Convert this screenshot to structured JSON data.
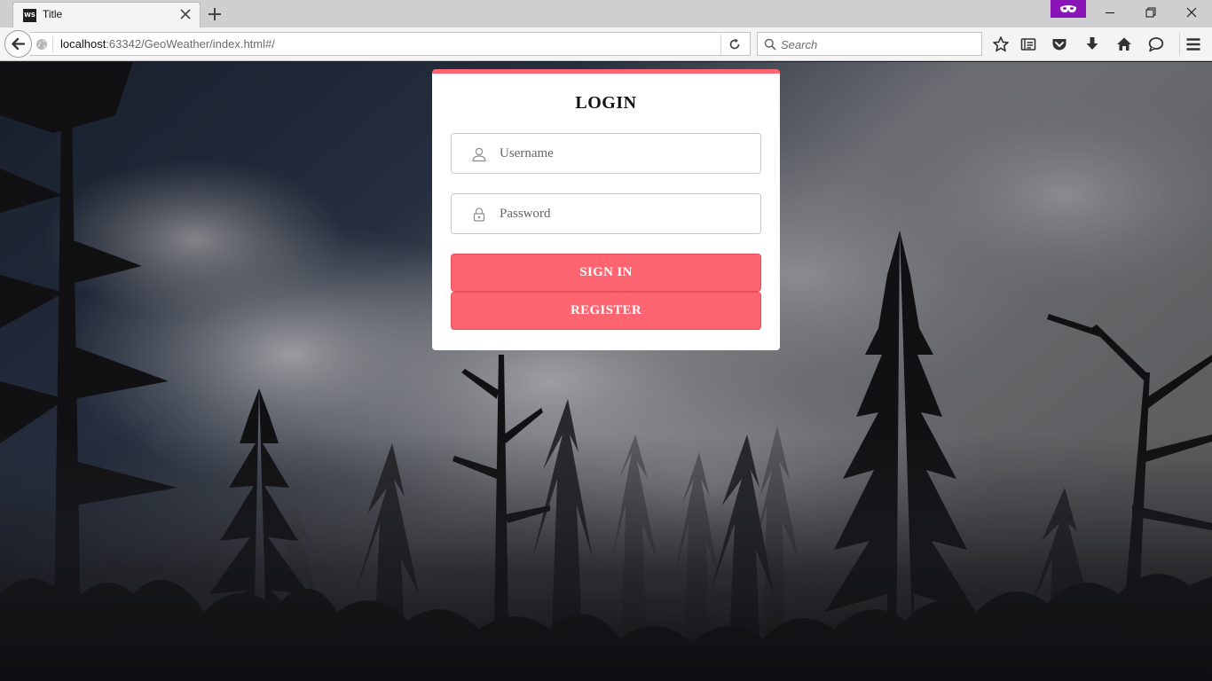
{
  "browser": {
    "tab_title": "Title",
    "tab_favicon": "WS",
    "url_host": "localhost",
    "url_rest": ":63342/GeoWeather/index.html#/",
    "search_placeholder": "Search",
    "accent_private": "#8a14b7"
  },
  "login": {
    "title": "LOGIN",
    "username_placeholder": "Username",
    "password_placeholder": "Password",
    "signin_label": "SIGN IN",
    "register_label": "REGISTER",
    "accent_color": "#ff6571"
  }
}
